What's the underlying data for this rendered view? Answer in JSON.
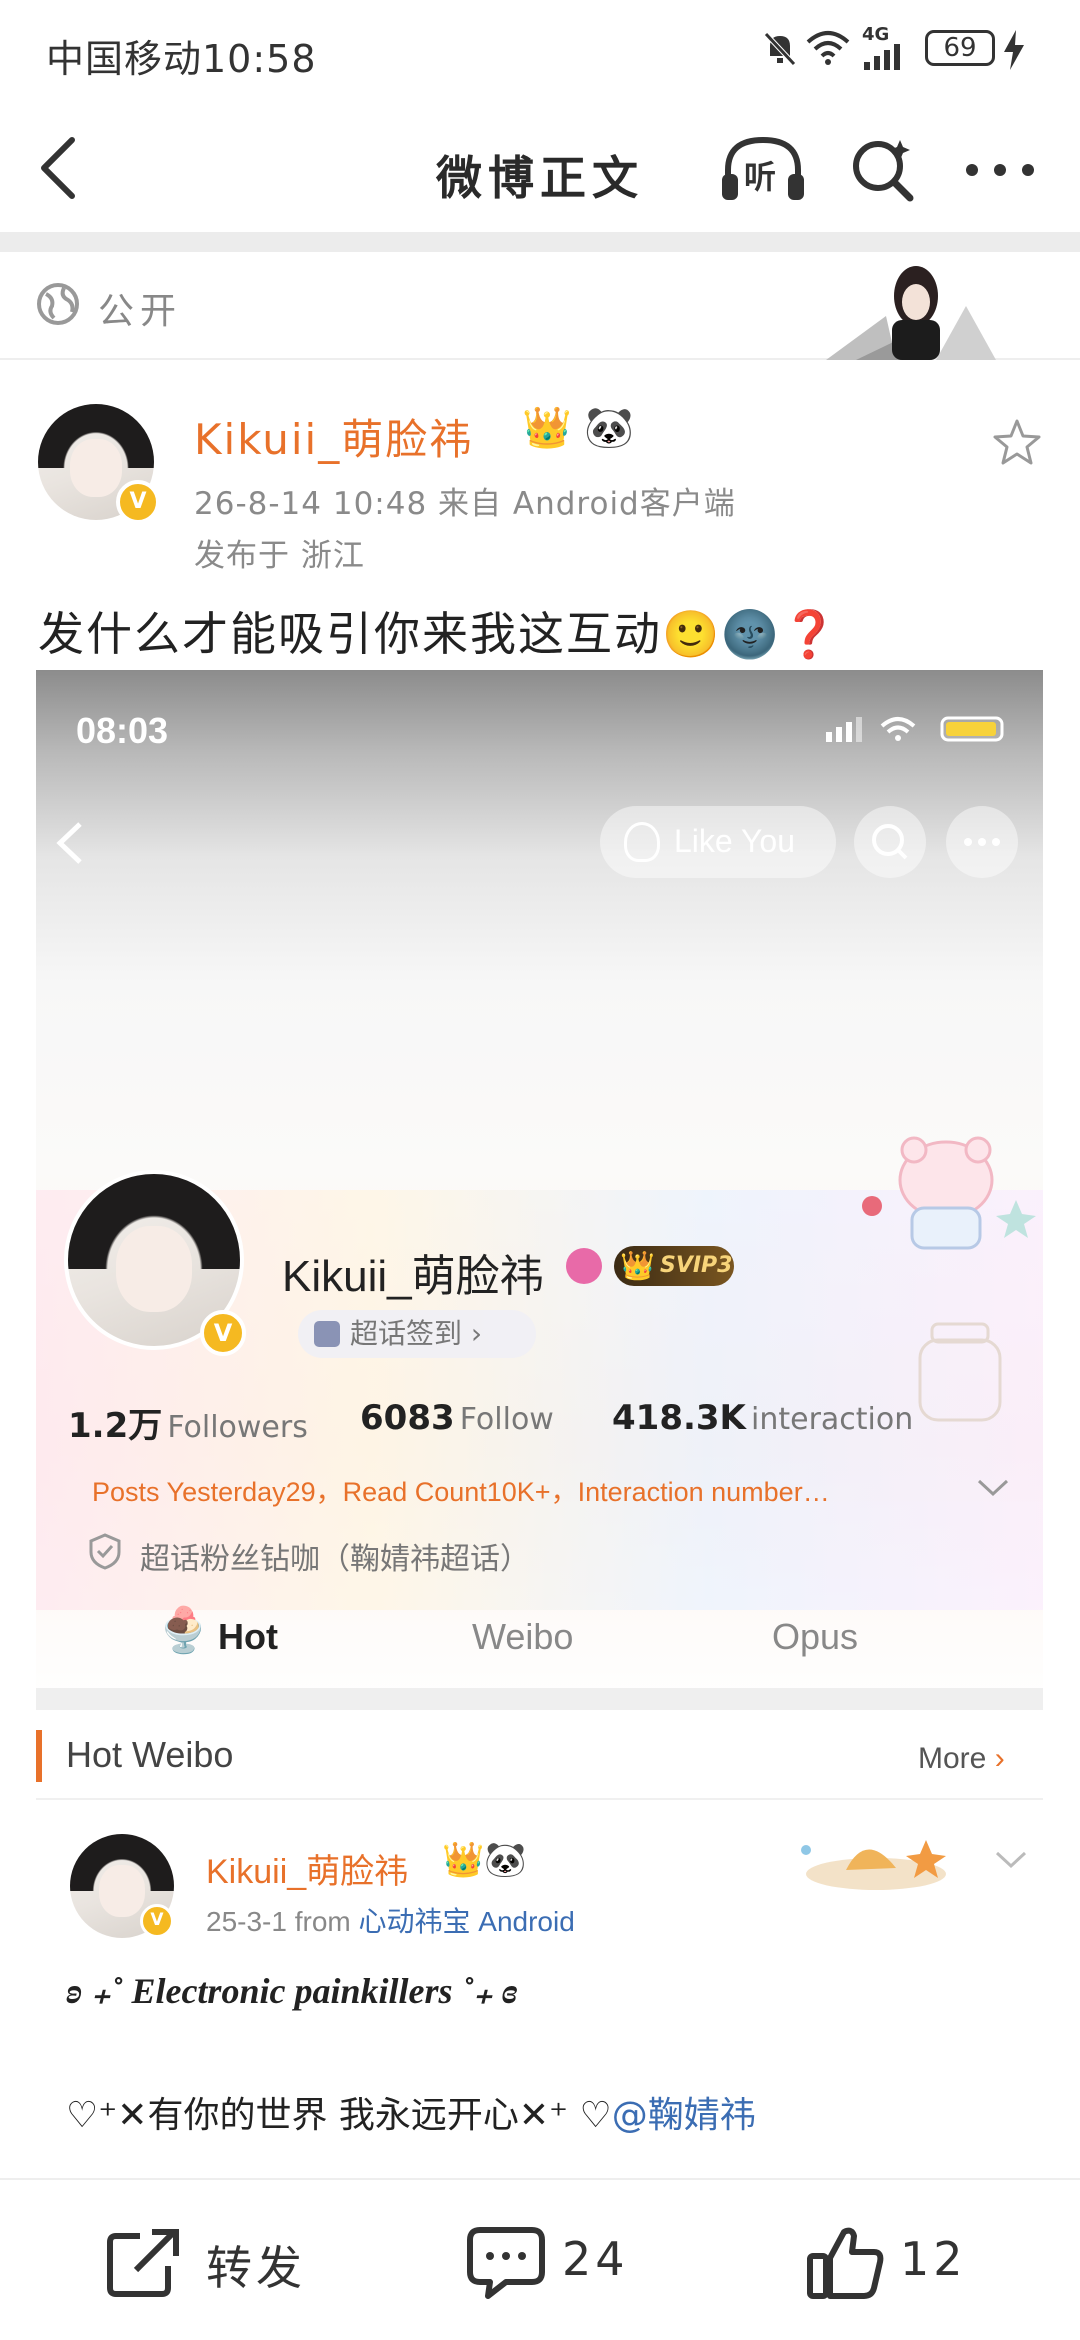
{
  "status_bar": {
    "carrier_time": "中国移动10:58",
    "network": "4G",
    "battery": "69",
    "icons": [
      "bell-mute-icon",
      "wifi-icon",
      "signal-icon",
      "battery-icon",
      "charging-icon"
    ]
  },
  "nav": {
    "title": "微博正文",
    "listen_label": "听",
    "icons": [
      "back-icon",
      "listen-icon",
      "search-icon",
      "more-icon"
    ]
  },
  "visibility": {
    "label": "公开"
  },
  "post": {
    "author": "Kikuii_萌脸祎",
    "time_source": "26-8-14 10:48  来自 Android客户端",
    "location": "发布于 浙江",
    "text": "发什么才能吸引你来我这互动",
    "emoji": [
      "🙂",
      "🌚",
      "❓"
    ],
    "author_badges": [
      "👑",
      "🐼"
    ]
  },
  "embedded": {
    "time": "08:03",
    "like_you": "Like You",
    "name": "Kikuii_萌脸祎",
    "svip": "SVIP3",
    "checkin": "超话签到 ›",
    "stats": [
      {
        "num": "1.2万",
        "label": "Followers"
      },
      {
        "num": "6083",
        "label": "Follow"
      },
      {
        "num": "418.3K",
        "label": "interaction"
      }
    ],
    "summary": "Posts Yesterday29，Read Count10K+，Interaction number…",
    "fan_line": "超话粉丝钻咖（鞠婧祎超话）",
    "tabs": [
      "Hot",
      "Weibo",
      "Opus"
    ],
    "hot_title": "Hot Weibo",
    "more": "More",
    "hot_post": {
      "author": "Kikuii_萌脸祎",
      "date": "25-3-1  from",
      "source": "心动祎宝 Android",
      "line1": "ʚ ₊˚ Electronic painkillers ˚₊ ɞ",
      "line2": "♡⁺✕有你的世界 我永远开心✕⁺ ♡",
      "mention": "@鞠婧祎"
    }
  },
  "bottom_bar": {
    "repost": "转发",
    "comments": "24",
    "likes": "12"
  },
  "colors": {
    "accent": "#e8712a",
    "link": "#3b6db3",
    "vip": "#f5b921"
  }
}
